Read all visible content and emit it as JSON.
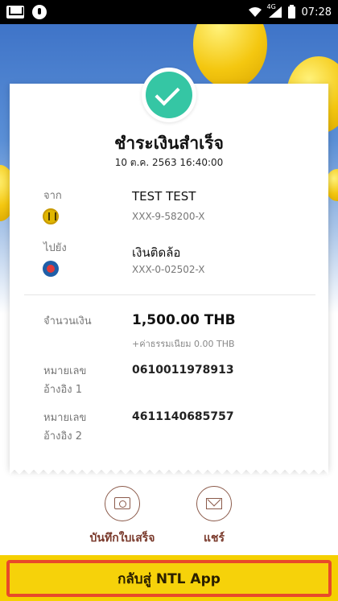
{
  "status_bar": {
    "time": "07:28",
    "network": "4G"
  },
  "receipt": {
    "title": "ชำระเงินสำเร็จ",
    "datetime": "10 ต.ค. 2563  16:40:00",
    "from": {
      "label": "จาก",
      "name": "TEST TEST",
      "account": "XXX-9-58200-X",
      "icon": "kbank-icon"
    },
    "to": {
      "label": "ไปยัง",
      "name": "เงินติดล้อ",
      "account": "XXX-0-02502-X",
      "icon": "bank-icon"
    },
    "amount": {
      "label": "จำนวนเงิน",
      "value": "1,500.00 THB",
      "fee": "+ค่าธรรมเนียม 0.00 THB"
    },
    "ref1": {
      "label_line1": "หมายเลข",
      "label_line2": "อ้างอิง 1",
      "value": "0610011978913"
    },
    "ref2": {
      "label_line1": "หมายเลข",
      "label_line2": "อ้างอิง 2",
      "value": "4611140685757"
    }
  },
  "actions": {
    "save_label": "บันทึกใบเสร็จ",
    "share_label": "แชร์"
  },
  "cta": {
    "label": "กลับสู่ NTL App"
  },
  "colors": {
    "success": "#35c6a4",
    "accent_yellow": "#f5d000",
    "cta_border": "#e84a2a",
    "action_brown": "#7a3a2c"
  }
}
